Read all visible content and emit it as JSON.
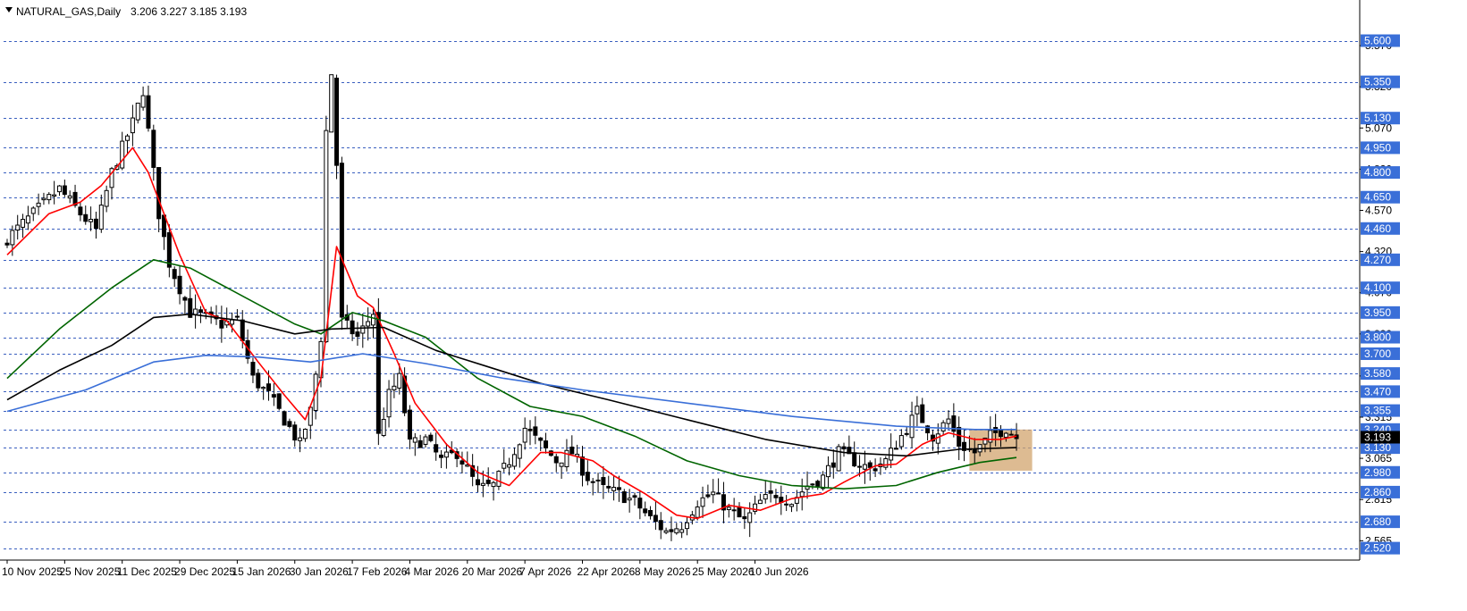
{
  "header": {
    "symbol": "NATURAL_GAS,Daily",
    "ohlc": "3.206 3.227 3.185 3.193"
  },
  "colors": {
    "background": "#ffffff",
    "grid": "#3a5fbf",
    "bull_candle": "#ffffff",
    "bear_candle": "#000000",
    "ma_fast": "#ff0000",
    "ma_mid": "#006400",
    "ma_slow": "#000000",
    "ma_long": "#3a6fd8",
    "box_fill": "#d2a46e",
    "price_tag": "#3a6fd8",
    "current_tag": "#000000"
  },
  "chart_data": {
    "type": "candlestick",
    "title": "NATURAL_GAS,Daily",
    "grid": true,
    "grid_style": "dashed-horizontal",
    "ylim": [
      2.48,
      5.76
    ],
    "price_levels": [
      "5.600",
      "5.350",
      "5.130",
      "4.950",
      "4.800",
      "4.650",
      "4.460",
      "4.270",
      "4.100",
      "3.950",
      "3.800",
      "3.700",
      "3.580",
      "3.470",
      "3.355",
      "3.240",
      "3.130",
      "2.980",
      "2.860",
      "2.680",
      "2.520"
    ],
    "y_ticks": [
      "5.570",
      "5.320",
      "5.070",
      "4.820",
      "4.570",
      "4.320",
      "4.070",
      "3.820",
      "3.565",
      "3.315",
      "3.065",
      "2.815",
      "2.565"
    ],
    "x_labels": [
      "10 Nov 2025",
      "25 Nov 2025",
      "11 Dec 2025",
      "29 Dec 2025",
      "15 Jan 2026",
      "30 Jan 2026",
      "17 Feb 2026",
      "4 Mar 2026",
      "20 Mar 2026",
      "7 Apr 2026",
      "22 Apr 2026",
      "8 May 2026",
      "25 May 2026",
      "10 Jun 2026"
    ],
    "label_every": 11,
    "current_price": "3.193",
    "anchors": [
      {
        "i": 0,
        "c": 4.4
      },
      {
        "i": 5,
        "c": 4.55
      },
      {
        "i": 10,
        "c": 4.7
      },
      {
        "i": 14,
        "c": 4.55
      },
      {
        "i": 17,
        "c": 4.45
      },
      {
        "i": 20,
        "c": 4.8
      },
      {
        "i": 24,
        "c": 5.1
      },
      {
        "i": 26,
        "c": 5.3
      },
      {
        "i": 27,
        "c": 5.05
      },
      {
        "i": 29,
        "c": 4.55
      },
      {
        "i": 31,
        "c": 4.25
      },
      {
        "i": 35,
        "c": 3.95
      },
      {
        "i": 38,
        "c": 3.92
      },
      {
        "i": 41,
        "c": 3.88
      },
      {
        "i": 44,
        "c": 3.9
      },
      {
        "i": 47,
        "c": 3.55
      },
      {
        "i": 50,
        "c": 3.45
      },
      {
        "i": 53,
        "c": 3.3
      },
      {
        "i": 56,
        "c": 3.15
      },
      {
        "i": 58,
        "c": 3.35
      },
      {
        "i": 60,
        "c": 3.8
      },
      {
        "i": 61,
        "c": 5.05
      },
      {
        "i": 62,
        "c": 5.4
      },
      {
        "i": 63,
        "c": 4.85
      },
      {
        "i": 64,
        "c": 3.9
      },
      {
        "i": 67,
        "c": 3.8
      },
      {
        "i": 70,
        "c": 3.95
      },
      {
        "i": 71,
        "c": 3.2
      },
      {
        "i": 73,
        "c": 3.45
      },
      {
        "i": 75,
        "c": 3.55
      },
      {
        "i": 77,
        "c": 3.15
      },
      {
        "i": 80,
        "c": 3.18
      },
      {
        "i": 83,
        "c": 3.05
      },
      {
        "i": 86,
        "c": 3.1
      },
      {
        "i": 88,
        "c": 3.0
      },
      {
        "i": 90,
        "c": 2.88
      },
      {
        "i": 93,
        "c": 2.9
      },
      {
        "i": 96,
        "c": 3.05
      },
      {
        "i": 99,
        "c": 3.25
      },
      {
        "i": 102,
        "c": 3.15
      },
      {
        "i": 105,
        "c": 3.05
      },
      {
        "i": 108,
        "c": 3.1
      },
      {
        "i": 111,
        "c": 2.95
      },
      {
        "i": 114,
        "c": 2.88
      },
      {
        "i": 117,
        "c": 2.85
      },
      {
        "i": 120,
        "c": 2.8
      },
      {
        "i": 123,
        "c": 2.7
      },
      {
        "i": 126,
        "c": 2.62
      },
      {
        "i": 129,
        "c": 2.66
      },
      {
        "i": 132,
        "c": 2.8
      },
      {
        "i": 135,
        "c": 2.85
      },
      {
        "i": 138,
        "c": 2.75
      },
      {
        "i": 141,
        "c": 2.68
      },
      {
        "i": 144,
        "c": 2.8
      },
      {
        "i": 147,
        "c": 2.85
      },
      {
        "i": 150,
        "c": 2.8
      },
      {
        "i": 153,
        "c": 2.9
      },
      {
        "i": 156,
        "c": 2.95
      },
      {
        "i": 159,
        "c": 3.1
      },
      {
        "i": 162,
        "c": 3.05
      },
      {
        "i": 165,
        "c": 3.0
      },
      {
        "i": 168,
        "c": 3.05
      },
      {
        "i": 171,
        "c": 3.2
      },
      {
        "i": 174,
        "c": 3.35
      },
      {
        "i": 177,
        "c": 3.2
      },
      {
        "i": 180,
        "c": 3.3
      },
      {
        "i": 182,
        "c": 3.15
      },
      {
        "i": 185,
        "c": 3.1
      },
      {
        "i": 188,
        "c": 3.2
      },
      {
        "i": 191,
        "c": 3.25
      },
      {
        "i": 193,
        "c": 3.193
      }
    ],
    "series": [
      {
        "name": "",
        "color": "#ff0000",
        "anchors": [
          {
            "i": 0,
            "c": 4.3
          },
          {
            "i": 8,
            "c": 4.55
          },
          {
            "i": 14,
            "c": 4.62
          },
          {
            "i": 18,
            "c": 4.72
          },
          {
            "i": 24,
            "c": 4.95
          },
          {
            "i": 27,
            "c": 4.8
          },
          {
            "i": 33,
            "c": 4.3
          },
          {
            "i": 38,
            "c": 3.95
          },
          {
            "i": 42,
            "c": 3.9
          },
          {
            "i": 48,
            "c": 3.65
          },
          {
            "i": 53,
            "c": 3.45
          },
          {
            "i": 57,
            "c": 3.3
          },
          {
            "i": 60,
            "c": 3.55
          },
          {
            "i": 63,
            "c": 4.35
          },
          {
            "i": 67,
            "c": 4.05
          },
          {
            "i": 70,
            "c": 3.98
          },
          {
            "i": 74,
            "c": 3.7
          },
          {
            "i": 78,
            "c": 3.4
          },
          {
            "i": 84,
            "c": 3.15
          },
          {
            "i": 90,
            "c": 2.98
          },
          {
            "i": 96,
            "c": 2.9
          },
          {
            "i": 102,
            "c": 3.1
          },
          {
            "i": 106,
            "c": 3.1
          },
          {
            "i": 112,
            "c": 3.05
          },
          {
            "i": 116,
            "c": 2.96
          },
          {
            "i": 122,
            "c": 2.85
          },
          {
            "i": 128,
            "c": 2.72
          },
          {
            "i": 132,
            "c": 2.7
          },
          {
            "i": 138,
            "c": 2.78
          },
          {
            "i": 144,
            "c": 2.75
          },
          {
            "i": 150,
            "c": 2.82
          },
          {
            "i": 156,
            "c": 2.85
          },
          {
            "i": 160,
            "c": 2.92
          },
          {
            "i": 166,
            "c": 3.02
          },
          {
            "i": 170,
            "c": 3.03
          },
          {
            "i": 175,
            "c": 3.15
          },
          {
            "i": 180,
            "c": 3.22
          },
          {
            "i": 185,
            "c": 3.18
          },
          {
            "i": 190,
            "c": 3.18
          },
          {
            "i": 193,
            "c": 3.2
          }
        ]
      },
      {
        "name": "",
        "color": "#006400",
        "anchors": [
          {
            "i": 0,
            "c": 3.55
          },
          {
            "i": 10,
            "c": 3.85
          },
          {
            "i": 20,
            "c": 4.1
          },
          {
            "i": 28,
            "c": 4.27
          },
          {
            "i": 35,
            "c": 4.22
          },
          {
            "i": 45,
            "c": 4.05
          },
          {
            "i": 55,
            "c": 3.88
          },
          {
            "i": 60,
            "c": 3.82
          },
          {
            "i": 66,
            "c": 3.95
          },
          {
            "i": 72,
            "c": 3.9
          },
          {
            "i": 80,
            "c": 3.8
          },
          {
            "i": 90,
            "c": 3.55
          },
          {
            "i": 100,
            "c": 3.38
          },
          {
            "i": 110,
            "c": 3.32
          },
          {
            "i": 120,
            "c": 3.2
          },
          {
            "i": 130,
            "c": 3.05
          },
          {
            "i": 140,
            "c": 2.96
          },
          {
            "i": 150,
            "c": 2.9
          },
          {
            "i": 160,
            "c": 2.88
          },
          {
            "i": 170,
            "c": 2.9
          },
          {
            "i": 178,
            "c": 2.98
          },
          {
            "i": 186,
            "c": 3.04
          },
          {
            "i": 193,
            "c": 3.07
          }
        ]
      },
      {
        "name": "",
        "color": "#000000",
        "anchors": [
          {
            "i": 0,
            "c": 3.42
          },
          {
            "i": 10,
            "c": 3.6
          },
          {
            "i": 20,
            "c": 3.75
          },
          {
            "i": 28,
            "c": 3.92
          },
          {
            "i": 35,
            "c": 3.94
          },
          {
            "i": 45,
            "c": 3.9
          },
          {
            "i": 55,
            "c": 3.82
          },
          {
            "i": 62,
            "c": 3.85
          },
          {
            "i": 72,
            "c": 3.86
          },
          {
            "i": 82,
            "c": 3.72
          },
          {
            "i": 92,
            "c": 3.62
          },
          {
            "i": 102,
            "c": 3.52
          },
          {
            "i": 115,
            "c": 3.42
          },
          {
            "i": 130,
            "c": 3.3
          },
          {
            "i": 145,
            "c": 3.18
          },
          {
            "i": 160,
            "c": 3.1
          },
          {
            "i": 172,
            "c": 3.08
          },
          {
            "i": 182,
            "c": 3.12
          },
          {
            "i": 193,
            "c": 3.13
          }
        ]
      },
      {
        "name": "",
        "color": "#3a6fd8",
        "anchors": [
          {
            "i": 0,
            "c": 3.35
          },
          {
            "i": 15,
            "c": 3.48
          },
          {
            "i": 28,
            "c": 3.65
          },
          {
            "i": 38,
            "c": 3.69
          },
          {
            "i": 48,
            "c": 3.68
          },
          {
            "i": 58,
            "c": 3.65
          },
          {
            "i": 68,
            "c": 3.7
          },
          {
            "i": 80,
            "c": 3.64
          },
          {
            "i": 95,
            "c": 3.55
          },
          {
            "i": 110,
            "c": 3.48
          },
          {
            "i": 130,
            "c": 3.4
          },
          {
            "i": 150,
            "c": 3.32
          },
          {
            "i": 170,
            "c": 3.26
          },
          {
            "i": 185,
            "c": 3.24
          },
          {
            "i": 193,
            "c": 3.24
          }
        ]
      }
    ],
    "highlight_box": {
      "from_index": 184,
      "to_index": 196,
      "y_top": 3.24,
      "y_bottom": 2.99
    }
  }
}
